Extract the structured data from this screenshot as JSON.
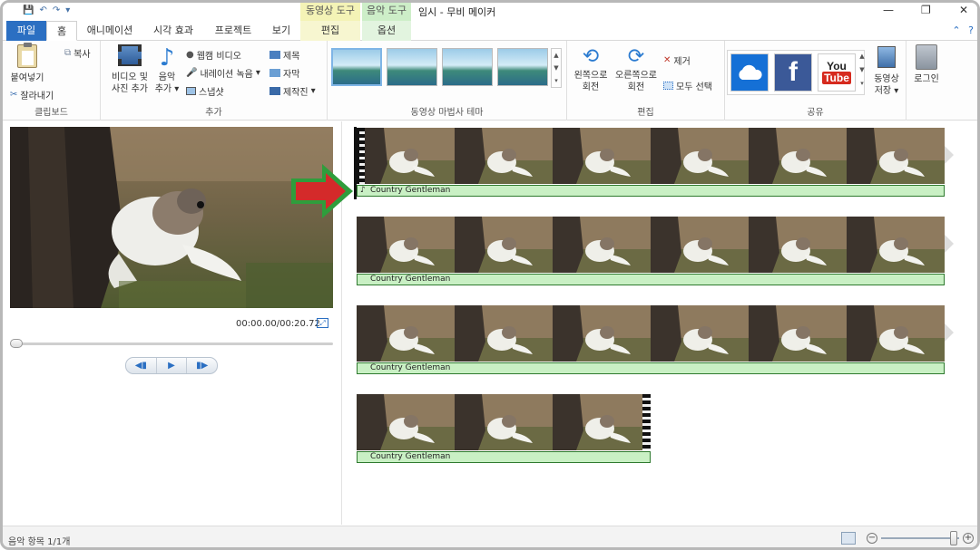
{
  "title_bar": {
    "title": "임시 - 무비 메이커",
    "contextual": {
      "video_tools": "동영상 도구",
      "audio_tools": "음악 도구"
    }
  },
  "tabs": [
    {
      "label": "파일"
    },
    {
      "label": "홈"
    },
    {
      "label": "애니메이션"
    },
    {
      "label": "시각 효과"
    },
    {
      "label": "프로젝트"
    },
    {
      "label": "보기"
    },
    {
      "label": "편집"
    },
    {
      "label": "옵션"
    }
  ],
  "ribbon": {
    "clipboard": {
      "label": "클립보드",
      "paste": "붙여넣기",
      "copy": "복사",
      "cut": "잘라내기"
    },
    "add": {
      "label": "추가",
      "add_video_line1": "비디오 및",
      "add_video_line2": "사진 추가",
      "music_line1": "음악",
      "music_line2": "추가",
      "webcam": "웹캠 비디오",
      "narration": "내레이션 녹음",
      "snapshot": "스냅샷",
      "title": "제목",
      "caption": "자막",
      "credits": "제작진"
    },
    "themes": {
      "label": "동영상 마법사 테마"
    },
    "edit": {
      "label": "편집",
      "rotate_left_line1": "왼쪽으로",
      "rotate_left_line2": "회전",
      "rotate_right_line1": "오른쪽으로",
      "rotate_right_line2": "회전",
      "remove": "제거",
      "select_all": "모두 선택"
    },
    "share": {
      "label": "공유",
      "save_line1": "동영상",
      "save_line2": "저장",
      "login": "로그인",
      "facebook": "f",
      "youtube_top": "You",
      "youtube_bottom": "Tube"
    }
  },
  "preview": {
    "timecode": "00:00.00/00:20.72",
    "seek_position": 0
  },
  "storyboard": {
    "rows": [
      {
        "music": "Country  Gentleman"
      },
      {
        "music": "Country  Gentleman"
      },
      {
        "music": "Country  Gentleman"
      },
      {
        "music": "Country  Gentleman"
      }
    ]
  },
  "status": {
    "text": "음악 항목 1/1개",
    "zoom_position": 0.95
  },
  "colors": {
    "file_tab": "#2b6fc2",
    "music_bar": "#c9f0c4",
    "arrow": "#d42a2a"
  }
}
